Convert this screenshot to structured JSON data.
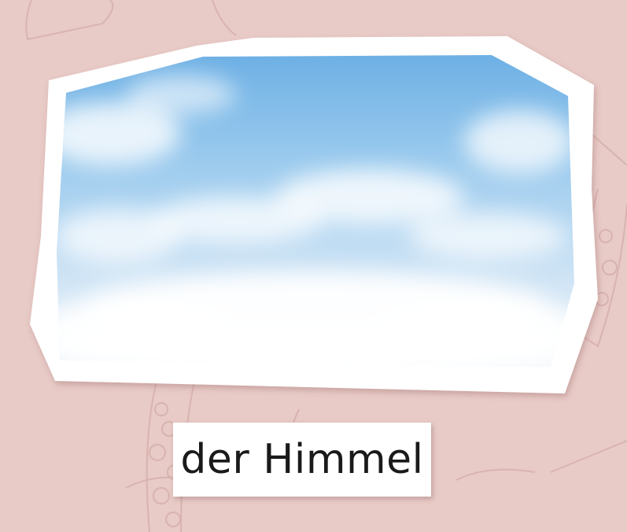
{
  "flashcard": {
    "word": "der Himmel",
    "image_subject": "sky-with-clouds-image"
  },
  "colors": {
    "background": "#e8cac6",
    "doodle_stroke": "#d9b4b0",
    "card_frame": "#ffffff",
    "sky_top": "#6fb3e6",
    "sky_bottom": "#f4f8fc",
    "label_text": "#1a1a1a"
  }
}
